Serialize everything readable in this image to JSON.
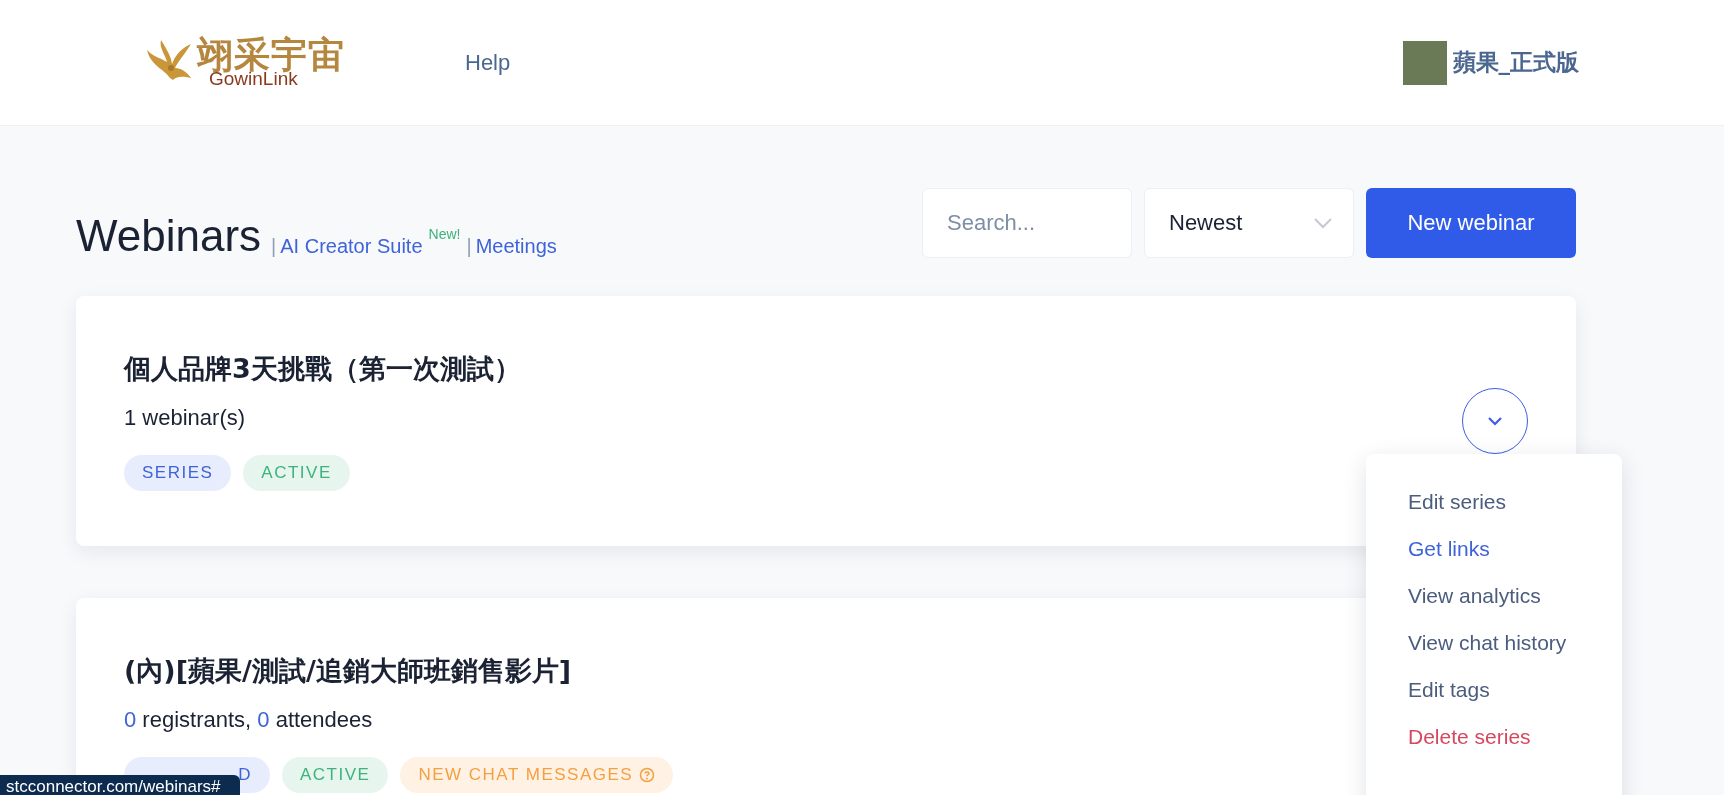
{
  "header": {
    "logo": {
      "title": "翊采宇宙",
      "subtitle": "GowinLink"
    },
    "nav": [
      {
        "label": "Help"
      }
    ],
    "user": {
      "name": "蘋果_正式版"
    }
  },
  "page": {
    "title": "Webinars",
    "links": [
      {
        "separator": "|",
        "label": "AI Creator Suite",
        "badge": "New!"
      },
      {
        "separator": "|",
        "label": "Meetings"
      }
    ],
    "search": {
      "placeholder": "Search..."
    },
    "sort": {
      "value": "Newest"
    },
    "new_button": "New webinar"
  },
  "cards": [
    {
      "title": "個人品牌3天挑戰（第一次測試）",
      "summary": [
        {
          "text": "1 webinar(s)",
          "kind": "plain"
        }
      ],
      "tags": [
        {
          "label": "SERIES",
          "kind": "series"
        },
        {
          "label": "ACTIVE",
          "kind": "active"
        }
      ],
      "expanded": true
    },
    {
      "title": "(**內**)[**蘋果/測試/追銷大師班銷售影片**]",
      "summary": [
        {
          "text": "0",
          "kind": "count"
        },
        {
          "text": " registrants, ",
          "kind": "plain"
        },
        {
          "text": "0",
          "kind": "count"
        },
        {
          "text": " attendees",
          "kind": "plain"
        }
      ],
      "tags": [
        {
          "label": "D",
          "kind": "series"
        },
        {
          "label": "ACTIVE",
          "kind": "active"
        },
        {
          "label": "NEW CHAT MESSAGES",
          "kind": "alert"
        }
      ],
      "expanded": false
    }
  ],
  "menu": [
    {
      "label": "Edit series",
      "kind": "normal"
    },
    {
      "label": "Get links",
      "kind": "link"
    },
    {
      "label": "View analytics",
      "kind": "normal"
    },
    {
      "label": "View chat history",
      "kind": "normal"
    },
    {
      "label": "Edit tags",
      "kind": "normal"
    },
    {
      "label": "Delete series",
      "kind": "danger"
    }
  ],
  "status_bar": {
    "url": "stcconnector.com/webinars#"
  }
}
